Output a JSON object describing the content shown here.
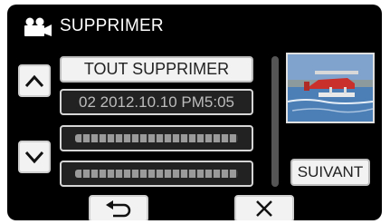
{
  "header": {
    "icon": "video-camera-icon",
    "title": "SUPPRIMER"
  },
  "list": {
    "up_icon": "chevron-up-icon",
    "down_icon": "chevron-down-icon",
    "delete_all_label": "TOUT SUPPRIMER",
    "items": [
      {
        "label": "02 2012.10.10 PM5:05"
      }
    ]
  },
  "preview": {
    "image": "seaplane-on-water-thumbnail"
  },
  "buttons": {
    "next_label": "SUIVANT",
    "back_icon": "return-arrow-icon",
    "close_icon": "close-icon"
  },
  "colors": {
    "background": "#000000",
    "button_face": "#f2f2f2"
  }
}
